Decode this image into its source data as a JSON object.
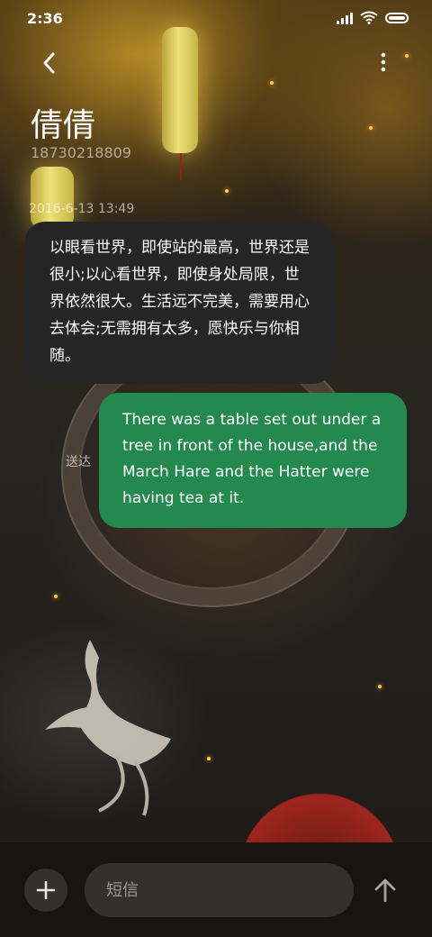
{
  "status_bar": {
    "time": "2:36"
  },
  "header": {
    "contact_name": "倩倩",
    "contact_number": "18730218809"
  },
  "conversation": {
    "timestamp": "2016-6-13 13:49",
    "messages": [
      {
        "direction": "incoming",
        "text": "以眼看世界，即使站的最高，世界还是很小;以心看世界，即使身处局限，世界依然很大。生活远不完美，需要用心去体会;无需拥有太多，愿快乐与你相随。"
      },
      {
        "direction": "outgoing",
        "text": "There was a table set out under a tree in front of the house,and the March Hare and the Hatter were having tea at it.",
        "status": "送达"
      }
    ]
  },
  "composer": {
    "placeholder": "短信",
    "add_icon": "plus-icon",
    "send_icon": "arrow-up-icon"
  },
  "colors": {
    "outgoing_bubble": "#23894e",
    "incoming_bubble": "#262525",
    "input_bar": "#1a1311"
  }
}
